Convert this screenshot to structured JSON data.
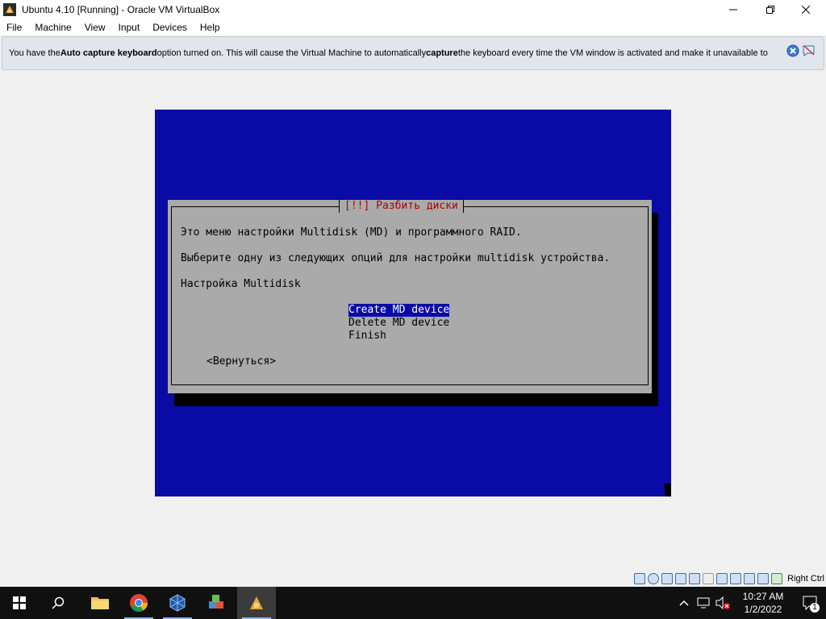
{
  "window": {
    "title": "Ubuntu 4.10 [Running] - Oracle VM VirtualBox",
    "minimize_icon": "minimize-icon",
    "maximize_icon": "maximize-icon",
    "close_icon": "close-icon"
  },
  "menu": {
    "items": [
      "File",
      "Machine",
      "View",
      "Input",
      "Devices",
      "Help"
    ]
  },
  "notice": {
    "part1": "You have the ",
    "bold1": "Auto capture keyboard",
    "part2": " option turned on. This will cause the Virtual Machine to automatically ",
    "bold2": "capture",
    "part3": " the keyboard every time the VM window is activated and make it unavailable to"
  },
  "vm": {
    "dialog_title": "[!!] Разбить диски",
    "line1": "Это меню настройки Multidisk (MD) и программного RAID.",
    "line2": "Выберите одну из следующих опций для настройки multidisk устройства.",
    "prompt": "Настройка Multidisk",
    "options": [
      "Create MD device",
      "Delete MD device",
      "Finish"
    ],
    "selected_index": 0,
    "back_button": "<Вернуться>"
  },
  "statusbar": {
    "host_key": "Right Ctrl"
  },
  "taskbar": {
    "time": "10:27 AM",
    "date": "1/2/2022",
    "notification_count": "1"
  },
  "colors": {
    "vm_background": "#0a0aa6",
    "dialog_background": "#aaaaaa",
    "dialog_title": "#aa0000",
    "selection": "#0a0aa6"
  }
}
